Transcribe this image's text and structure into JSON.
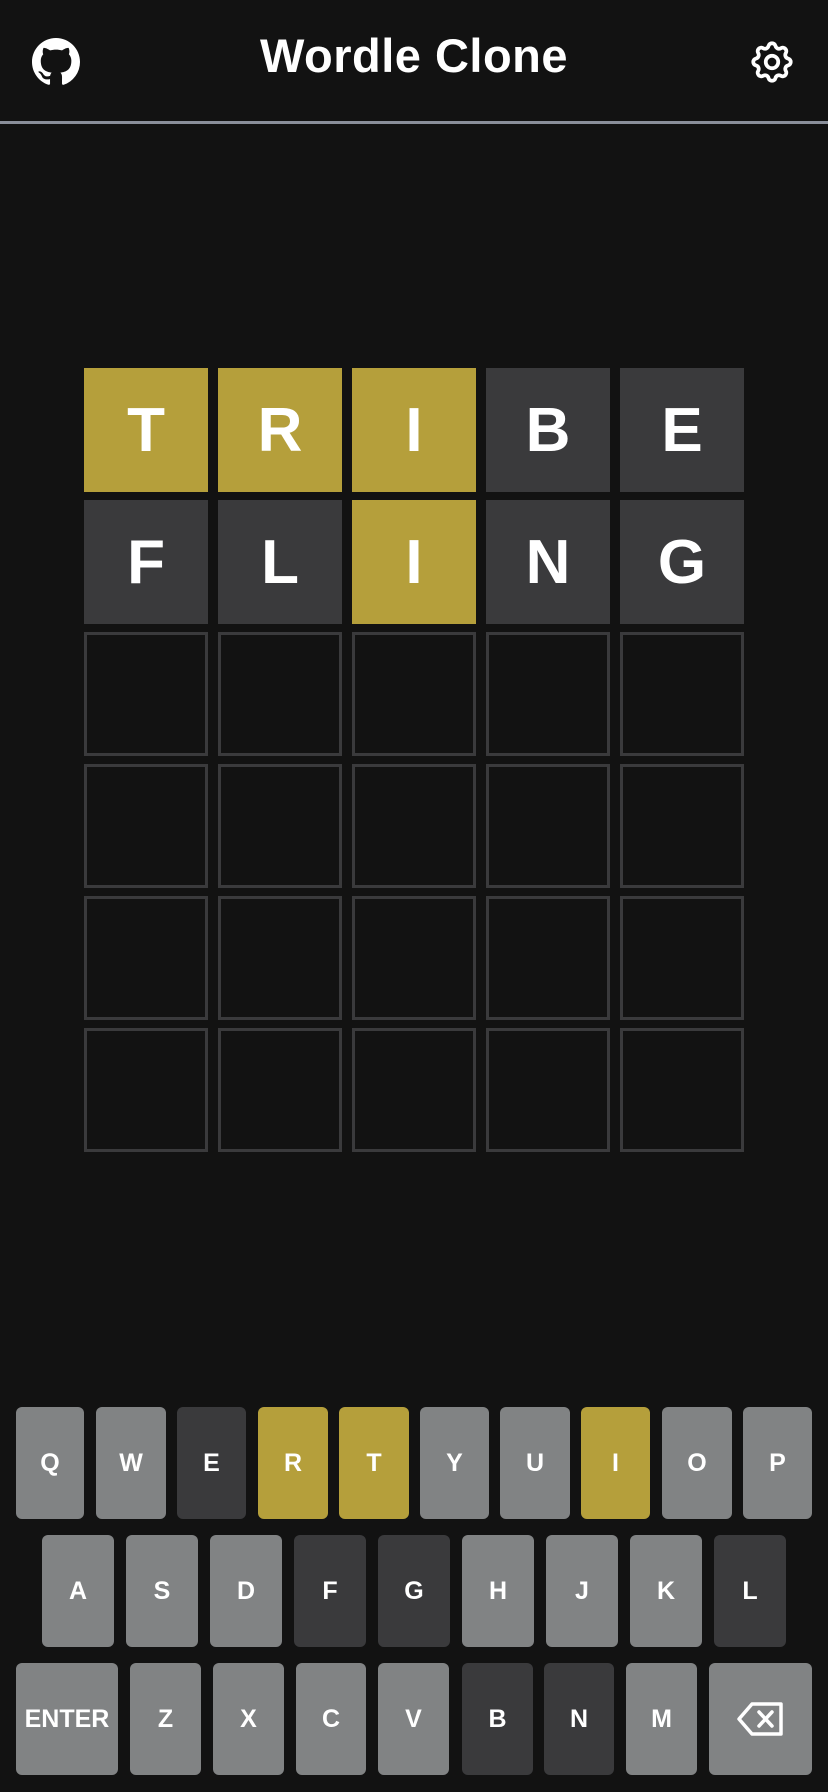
{
  "header": {
    "title": "Wordle Clone",
    "left_icon": "github-icon",
    "right_icon": "gear-icon"
  },
  "colors": {
    "background": "#121212",
    "present": "#b59f3b",
    "absent": "#3a3a3c",
    "unused_key": "#818384",
    "empty_border": "#3a3a3c",
    "header_divider": "#8a8f9a"
  },
  "board": {
    "rows": [
      [
        {
          "letter": "T",
          "state": "present"
        },
        {
          "letter": "R",
          "state": "present"
        },
        {
          "letter": "I",
          "state": "present"
        },
        {
          "letter": "B",
          "state": "absent"
        },
        {
          "letter": "E",
          "state": "absent"
        }
      ],
      [
        {
          "letter": "F",
          "state": "absent"
        },
        {
          "letter": "L",
          "state": "absent"
        },
        {
          "letter": "I",
          "state": "present"
        },
        {
          "letter": "N",
          "state": "absent"
        },
        {
          "letter": "G",
          "state": "absent"
        }
      ],
      [
        {
          "letter": "",
          "state": "empty"
        },
        {
          "letter": "",
          "state": "empty"
        },
        {
          "letter": "",
          "state": "empty"
        },
        {
          "letter": "",
          "state": "empty"
        },
        {
          "letter": "",
          "state": "empty"
        }
      ],
      [
        {
          "letter": "",
          "state": "empty"
        },
        {
          "letter": "",
          "state": "empty"
        },
        {
          "letter": "",
          "state": "empty"
        },
        {
          "letter": "",
          "state": "empty"
        },
        {
          "letter": "",
          "state": "empty"
        }
      ],
      [
        {
          "letter": "",
          "state": "empty"
        },
        {
          "letter": "",
          "state": "empty"
        },
        {
          "letter": "",
          "state": "empty"
        },
        {
          "letter": "",
          "state": "empty"
        },
        {
          "letter": "",
          "state": "empty"
        }
      ],
      [
        {
          "letter": "",
          "state": "empty"
        },
        {
          "letter": "",
          "state": "empty"
        },
        {
          "letter": "",
          "state": "empty"
        },
        {
          "letter": "",
          "state": "empty"
        },
        {
          "letter": "",
          "state": "empty"
        }
      ]
    ]
  },
  "keyboard": {
    "rows": [
      [
        {
          "label": "Q",
          "state": "unused"
        },
        {
          "label": "W",
          "state": "unused"
        },
        {
          "label": "E",
          "state": "absent"
        },
        {
          "label": "R",
          "state": "present"
        },
        {
          "label": "T",
          "state": "present"
        },
        {
          "label": "Y",
          "state": "unused"
        },
        {
          "label": "U",
          "state": "unused"
        },
        {
          "label": "I",
          "state": "present"
        },
        {
          "label": "O",
          "state": "unused"
        },
        {
          "label": "P",
          "state": "unused"
        }
      ],
      [
        {
          "label": "A",
          "state": "unused"
        },
        {
          "label": "S",
          "state": "unused"
        },
        {
          "label": "D",
          "state": "unused"
        },
        {
          "label": "F",
          "state": "absent"
        },
        {
          "label": "G",
          "state": "absent"
        },
        {
          "label": "H",
          "state": "unused"
        },
        {
          "label": "J",
          "state": "unused"
        },
        {
          "label": "K",
          "state": "unused"
        },
        {
          "label": "L",
          "state": "absent"
        }
      ],
      [
        {
          "label": "ENTER",
          "state": "unused"
        },
        {
          "label": "Z",
          "state": "unused"
        },
        {
          "label": "X",
          "state": "unused"
        },
        {
          "label": "C",
          "state": "unused"
        },
        {
          "label": "V",
          "state": "unused"
        },
        {
          "label": "B",
          "state": "absent"
        },
        {
          "label": "N",
          "state": "absent"
        },
        {
          "label": "M",
          "state": "unused"
        },
        {
          "label": "",
          "icon": "backspace-icon",
          "state": "unused"
        }
      ]
    ]
  }
}
